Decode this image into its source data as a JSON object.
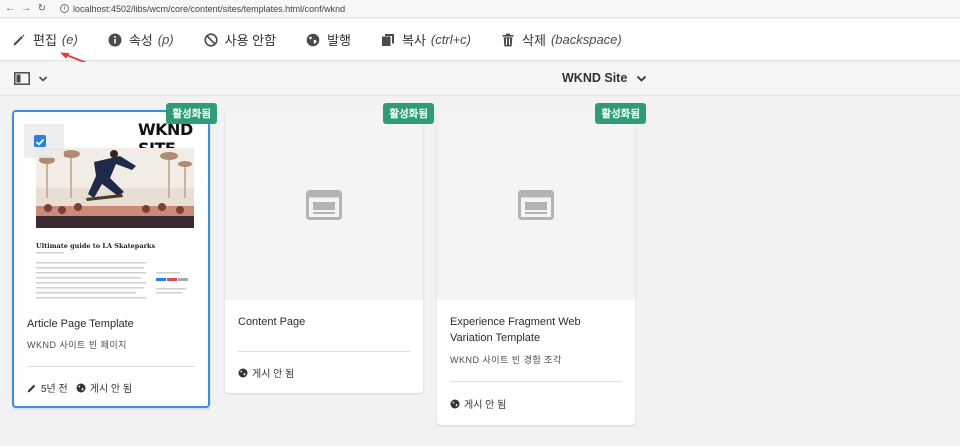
{
  "browser": {
    "url": "localhost:4502/libs/wcm/core/content/sites/templates.html/conf/wknd"
  },
  "actions": [
    {
      "label": "편집",
      "hint": "(e)"
    },
    {
      "label": "속성",
      "hint": "(p)"
    },
    {
      "label": "사용 안함",
      "hint": ""
    },
    {
      "label": "발행",
      "hint": ""
    },
    {
      "label": "복사",
      "hint": "(ctrl+c)"
    },
    {
      "label": "삭제",
      "hint": "(backspace)"
    }
  ],
  "site_switcher": {
    "label": "WKND Site"
  },
  "cards": [
    {
      "badge": "활성화됨",
      "title": "Article Page Template",
      "subtitle": "WKND 사이트 빈 페이지",
      "modified": "5년 전",
      "publish_status": "게시 안 됨",
      "preview": {
        "brand": "WKND SITE",
        "headline": "Ultimate guide to LA Skateparks"
      }
    },
    {
      "badge": "활성화됨",
      "title": "Content Page",
      "subtitle": "",
      "publish_status": "게시 안 됨"
    },
    {
      "badge": "활성화됨",
      "title": "Experience Fragment Web Variation Template",
      "subtitle": "WKND 사이트 빈 경험 조각",
      "publish_status": "게시 안 됨"
    }
  ],
  "colors": {
    "badge": "#2d9d78",
    "selection": "#378ef0",
    "annotation_arrow": "#e53935"
  }
}
